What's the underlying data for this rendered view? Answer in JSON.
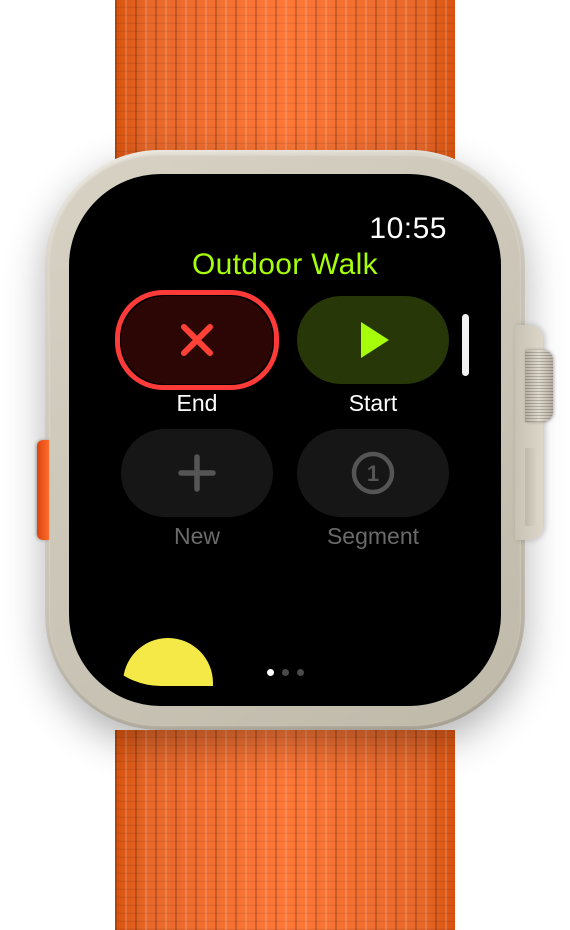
{
  "status": {
    "time": "10:55"
  },
  "workout": {
    "title": "Outdoor Walk"
  },
  "buttons": {
    "end": {
      "label": "End",
      "icon": "close-icon",
      "color": "#fd4137"
    },
    "start": {
      "label": "Start",
      "icon": "play-icon",
      "color": "#a6fe0a"
    },
    "new": {
      "label": "New",
      "icon": "plus-icon",
      "color": "#555555"
    },
    "segment": {
      "label": "Segment",
      "icon": "segment-icon",
      "color": "#555555"
    }
  },
  "pagination": {
    "pages": 3,
    "active": 0
  },
  "highlight": "end"
}
